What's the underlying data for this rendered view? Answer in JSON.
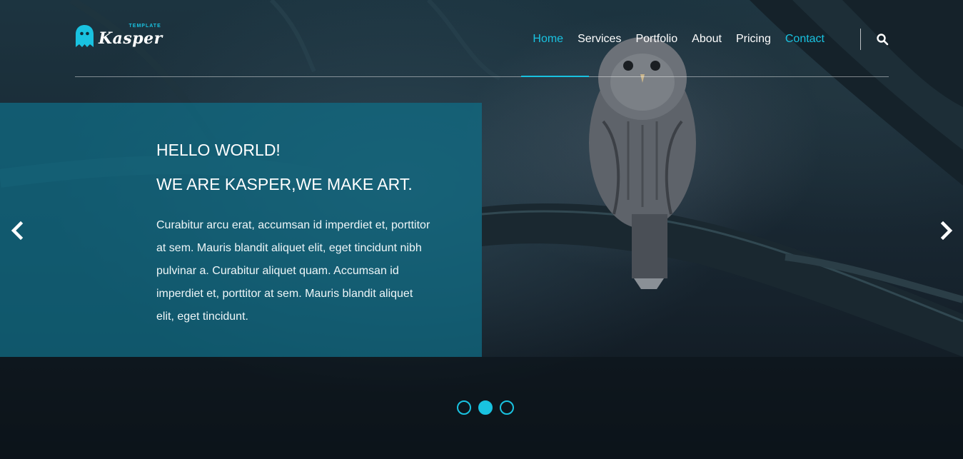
{
  "brand": {
    "name": "Kasper",
    "tagline": "TEMPLATE",
    "accent": "#19c2e0"
  },
  "nav": {
    "items": [
      {
        "label": "Home",
        "state": "active"
      },
      {
        "label": "Services",
        "state": "normal"
      },
      {
        "label": "Portfolio",
        "state": "normal"
      },
      {
        "label": "About",
        "state": "normal"
      },
      {
        "label": "Pricing",
        "state": "normal"
      },
      {
        "label": "Contact",
        "state": "highlight"
      }
    ],
    "search_icon": "search-icon"
  },
  "slide": {
    "heading1": "HELLO WORLD!",
    "heading2": "WE ARE KASPER,WE MAKE ART.",
    "body_lines": [
      "Curabitur arcu erat, accumsan id imperdiet et, porttitor",
      "at sem. Mauris blandit aliquet elit, eget tincidunt nibh",
      "pulvinar a. Curabitur aliquet quam. Accumsan id",
      "imperdiet et, porttitor at sem. Mauris blandit aliquet",
      "elit, eget tincidunt."
    ]
  },
  "carousel": {
    "prev_icon": "chevron-left-icon",
    "next_icon": "chevron-right-icon",
    "slide_count": 3,
    "active_index": 1
  }
}
